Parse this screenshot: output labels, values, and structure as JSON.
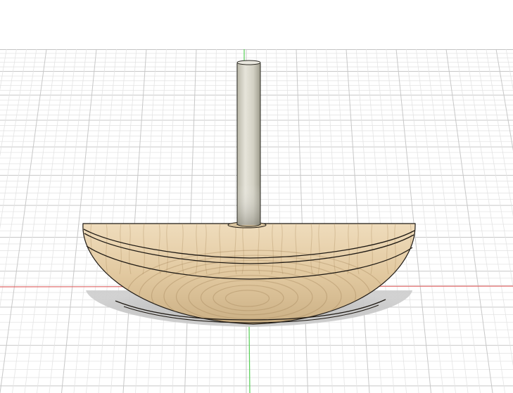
{
  "viewport": {
    "background_color": "#ffffff",
    "grid_color_minor": "#e4e4e4",
    "grid_color_major": "#c8c8c8",
    "grid_border_color": "#8a8a8a",
    "x_axis_color": "#e06060",
    "y_axis_color": "#4fce4f"
  },
  "model": {
    "wood_light": "#ecd9b8",
    "wood_mid": "#d9bf93",
    "wood_dark": "#b89a6e",
    "dowel_light": "#e4e2d8",
    "dowel_dark": "#a9a797",
    "shadow_color": "#bdbdbd",
    "edge_color": "#1f1a14"
  }
}
